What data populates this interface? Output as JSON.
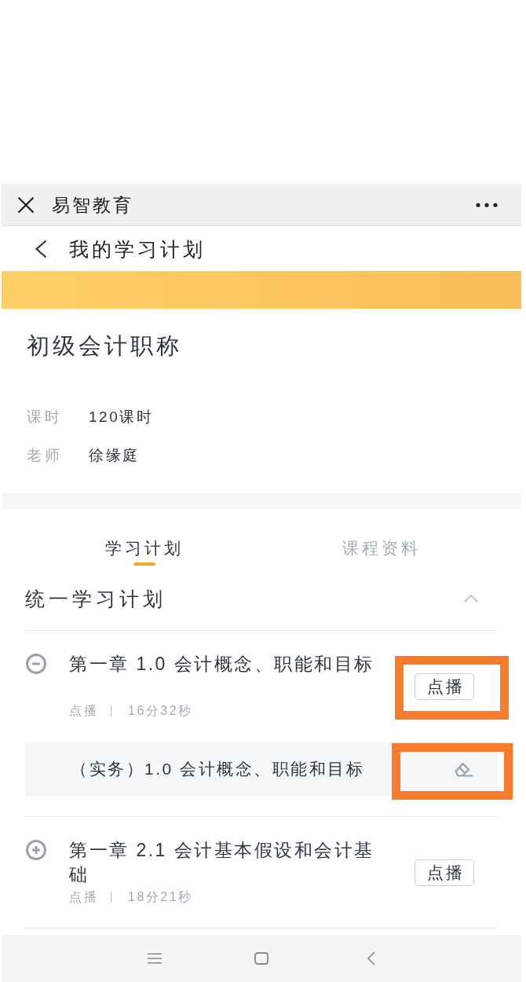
{
  "app_bar": {
    "title": "易智教育"
  },
  "nav": {
    "title": "我的学习计划"
  },
  "course": {
    "title": "初级会计职称",
    "info": [
      {
        "label": "课时",
        "value": "120课时"
      },
      {
        "label": "老师",
        "value": "徐缘庭"
      }
    ]
  },
  "tabs": [
    {
      "label": "学习计划",
      "selected": true
    },
    {
      "label": "课程资料",
      "selected": false
    }
  ],
  "plan": {
    "title": "统一学习计划",
    "expanded": true,
    "chapters": [
      {
        "title": "第一章 1.0 会计概念、职能和目标",
        "expanded": true,
        "format": "点播",
        "duration": "16分32秒",
        "button": "点播",
        "highlighted": true,
        "lessons": [
          {
            "title": "（实务）1.0 会计概念、职能和目标",
            "highlighted": true
          }
        ]
      },
      {
        "title": "第一章 2.1 会计基本假设和会计基础",
        "expanded": false,
        "format": "点播",
        "duration": "18分21秒",
        "button": "点播",
        "highlighted": false
      }
    ]
  }
}
